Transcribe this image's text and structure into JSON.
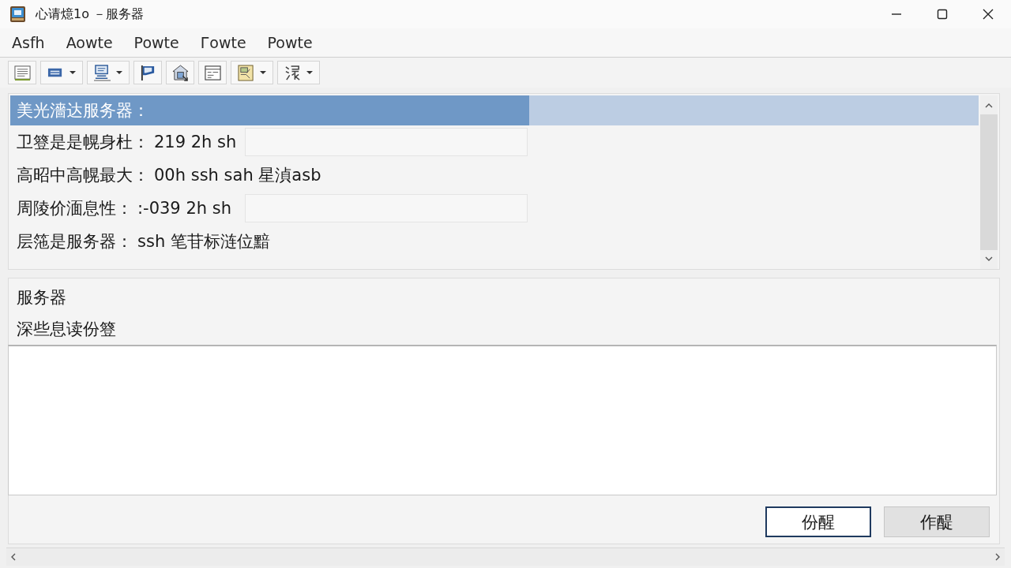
{
  "window": {
    "title": "心请燱1o －服务器"
  },
  "menu": [
    "Asfh",
    "Aowte",
    "Powte",
    "Гowte",
    "Powte"
  ],
  "toolbar": [
    {
      "kind": "document",
      "dropdown": false
    },
    {
      "kind": "window",
      "dropdown": true
    },
    {
      "kind": "monitor",
      "dropdown": true
    },
    {
      "kind": "flag",
      "dropdown": false
    },
    {
      "kind": "house",
      "dropdown": false
    },
    {
      "kind": "list",
      "dropdown": false
    },
    {
      "kind": "panel",
      "dropdown": true
    },
    {
      "kind": "network",
      "dropdown": true
    }
  ],
  "properties": {
    "rows": [
      {
        "kind": "header",
        "label": "美光濇达服务器：",
        "selected": true
      },
      {
        "kind": "field",
        "label": "卫簦是是幌身杜：",
        "value": "219 2h sh",
        "selected": false
      },
      {
        "kind": "plain",
        "label": "高昭中高幌最大：",
        "value": "00h ssh sah 星湞asb",
        "selected": false
      },
      {
        "kind": "field",
        "label": "周陵价湎息性：",
        "value": ":-039 2h sh",
        "selected": false
      },
      {
        "kind": "plain",
        "label": "层筂是服务器：",
        "value": "ssh 笔苷标涟位黯",
        "selected": false
      }
    ]
  },
  "details": {
    "heading": "服务器",
    "label": "深些息读份簦"
  },
  "buttons": [
    {
      "label": "份醒",
      "default": true
    },
    {
      "label": "作醍",
      "default": false
    }
  ]
}
